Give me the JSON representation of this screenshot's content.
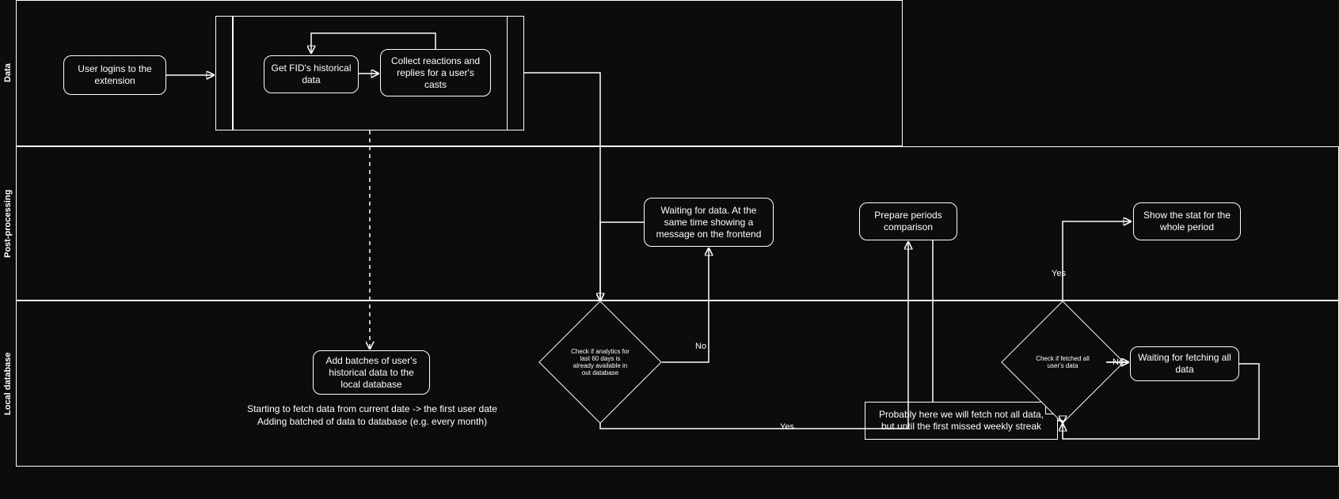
{
  "lanes": {
    "data": {
      "label": "Data"
    },
    "post": {
      "label": "Post-processing"
    },
    "local": {
      "label": "Local database"
    }
  },
  "nodes": {
    "login": {
      "label": "User logins to the extension"
    },
    "getHist": {
      "label": "Get FID's historical data"
    },
    "collect": {
      "label": "Collect reactions and replies for a user's casts"
    },
    "waiting": {
      "label": "Waiting for data. At the same time showing a message on the frontend"
    },
    "prepare": {
      "label": "Prepare periods comparison"
    },
    "showStat": {
      "label": "Show the stat for the whole period"
    },
    "addBatches": {
      "label": "Add batches of user's historical data to the local database"
    },
    "waitAll": {
      "label": "Waiting for fetching all data"
    }
  },
  "decisions": {
    "check60": {
      "label": "Check if analytics for last 60 days is already available  in out database"
    },
    "checkAll": {
      "label": "Check if fetched all user's data"
    }
  },
  "notes": {
    "probably": {
      "label": "Probably here we will fetch not all data, but until the first missed weekly streak"
    }
  },
  "freetext": {
    "fetchNote": {
      "line1": "Starting to fetch data from current date -> the first user date",
      "line2": "Adding batched of data to database (e.g. every month)"
    }
  },
  "edgeLabels": {
    "no1": "No",
    "yes1": "Yes",
    "no2": "No",
    "yes2": "Yes"
  }
}
